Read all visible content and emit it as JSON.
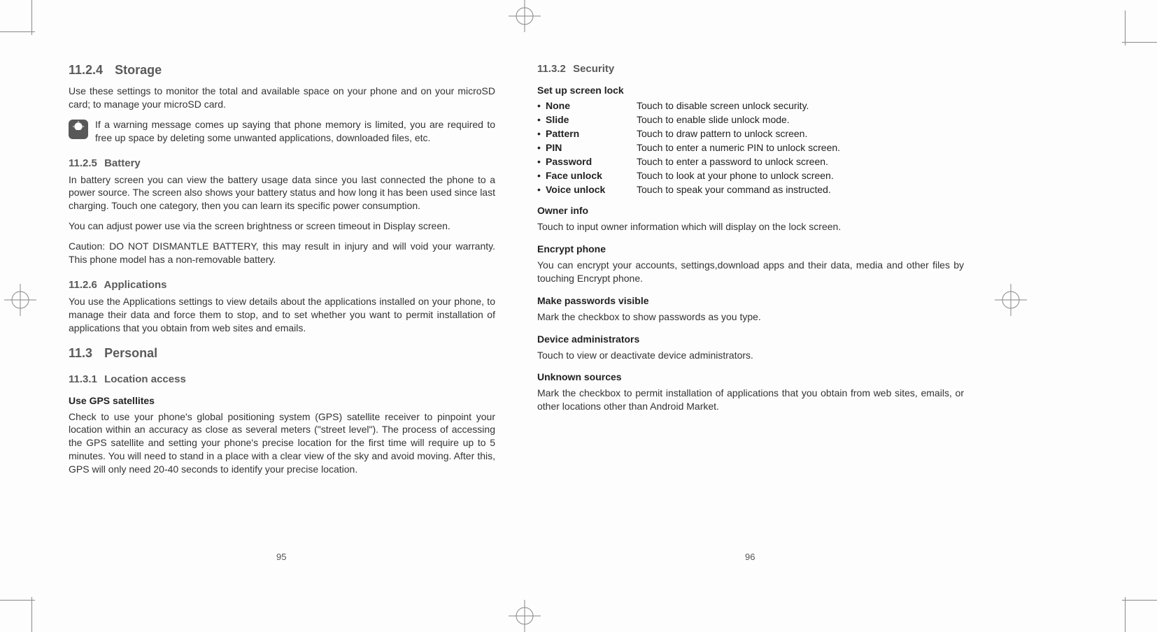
{
  "left_page": {
    "storage": {
      "heading_num": "11.2.4",
      "heading_text": "Storage",
      "body1": "Use these settings to monitor the total and available space on your phone and on your microSD card; to manage your microSD card.",
      "note_text": "If a warning message comes up saying that phone memory is limited, you are required to free up space by deleting some unwanted applications, downloaded files, etc."
    },
    "battery": {
      "heading_num": "11.2.5",
      "heading_text": "Battery",
      "body1": "In battery screen you can view the battery usage data since you last connected the phone to a power source. The screen also shows your battery status and how long it has been used since last charging. Touch one category, then you can learn its specific power consumption.",
      "body2": "You can adjust power use via the screen brightness or screen timeout in Display screen.",
      "body3": "Caution: DO NOT DISMANTLE BATTERY, this may result in injury and will void your warranty. This phone model has a non-removable battery."
    },
    "applications": {
      "heading_num": "11.2.6",
      "heading_text": "Applications",
      "body1": "You use the Applications settings to view details about the applications installed on your phone, to manage their data and force them to stop, and to set whether you want to permit installation of applications that you obtain from web sites and emails."
    },
    "personal": {
      "heading_num": "11.3",
      "heading_text": "Personal",
      "loc_num": "11.3.1",
      "loc_text": "Location access",
      "gps_heading": "Use GPS satellites",
      "gps_body": "Check to use your phone's global positioning system (GPS) satellite receiver to pinpoint your location within an accuracy as close as several meters (\"street level\"). The process of accessing the GPS satellite and setting your phone's precise location for the first time will require up to 5 minutes. You will need to stand in a place with a clear view of the sky and avoid moving. After this, GPS will only need 20-40 seconds to identify your precise location."
    },
    "page_number": "95"
  },
  "right_page": {
    "security": {
      "heading_num": "11.3.2",
      "heading_text": "Security",
      "lock_heading": "Set up screen lock",
      "lock_items": [
        {
          "term": "None",
          "desc": "Touch to disable screen unlock security."
        },
        {
          "term": "Slide",
          "desc": "Touch to enable slide unlock mode."
        },
        {
          "term": "Pattern",
          "desc": "Touch to draw pattern to unlock screen."
        },
        {
          "term": "PIN",
          "desc": "Touch to enter a numeric PIN to unlock screen."
        },
        {
          "term": "Password",
          "desc": "Touch to enter a password to unlock screen."
        },
        {
          "term": "Face unlock",
          "desc": "Touch to look at your phone to unlock screen."
        },
        {
          "term": "Voice unlock",
          "desc": "Touch to speak your command as instructed."
        }
      ],
      "owner_heading": "Owner info",
      "owner_body": "Touch to input owner information which will display on the lock screen.",
      "encrypt_heading": "Encrypt phone",
      "encrypt_body": "You can encrypt your accounts, settings,download apps and their data, media and other files by touching Encrypt phone.",
      "visible_heading": "Make passwords visible",
      "visible_body": "Mark the checkbox to show passwords as you type.",
      "admin_heading": "Device administrators",
      "admin_body": "Touch to view or deactivate device administrators.",
      "unknown_heading": "Unknown sources",
      "unknown_body": "Mark the checkbox to permit installation of applications that you obtain from web sites, emails, or other locations other than Android Market."
    },
    "page_number": "96"
  }
}
